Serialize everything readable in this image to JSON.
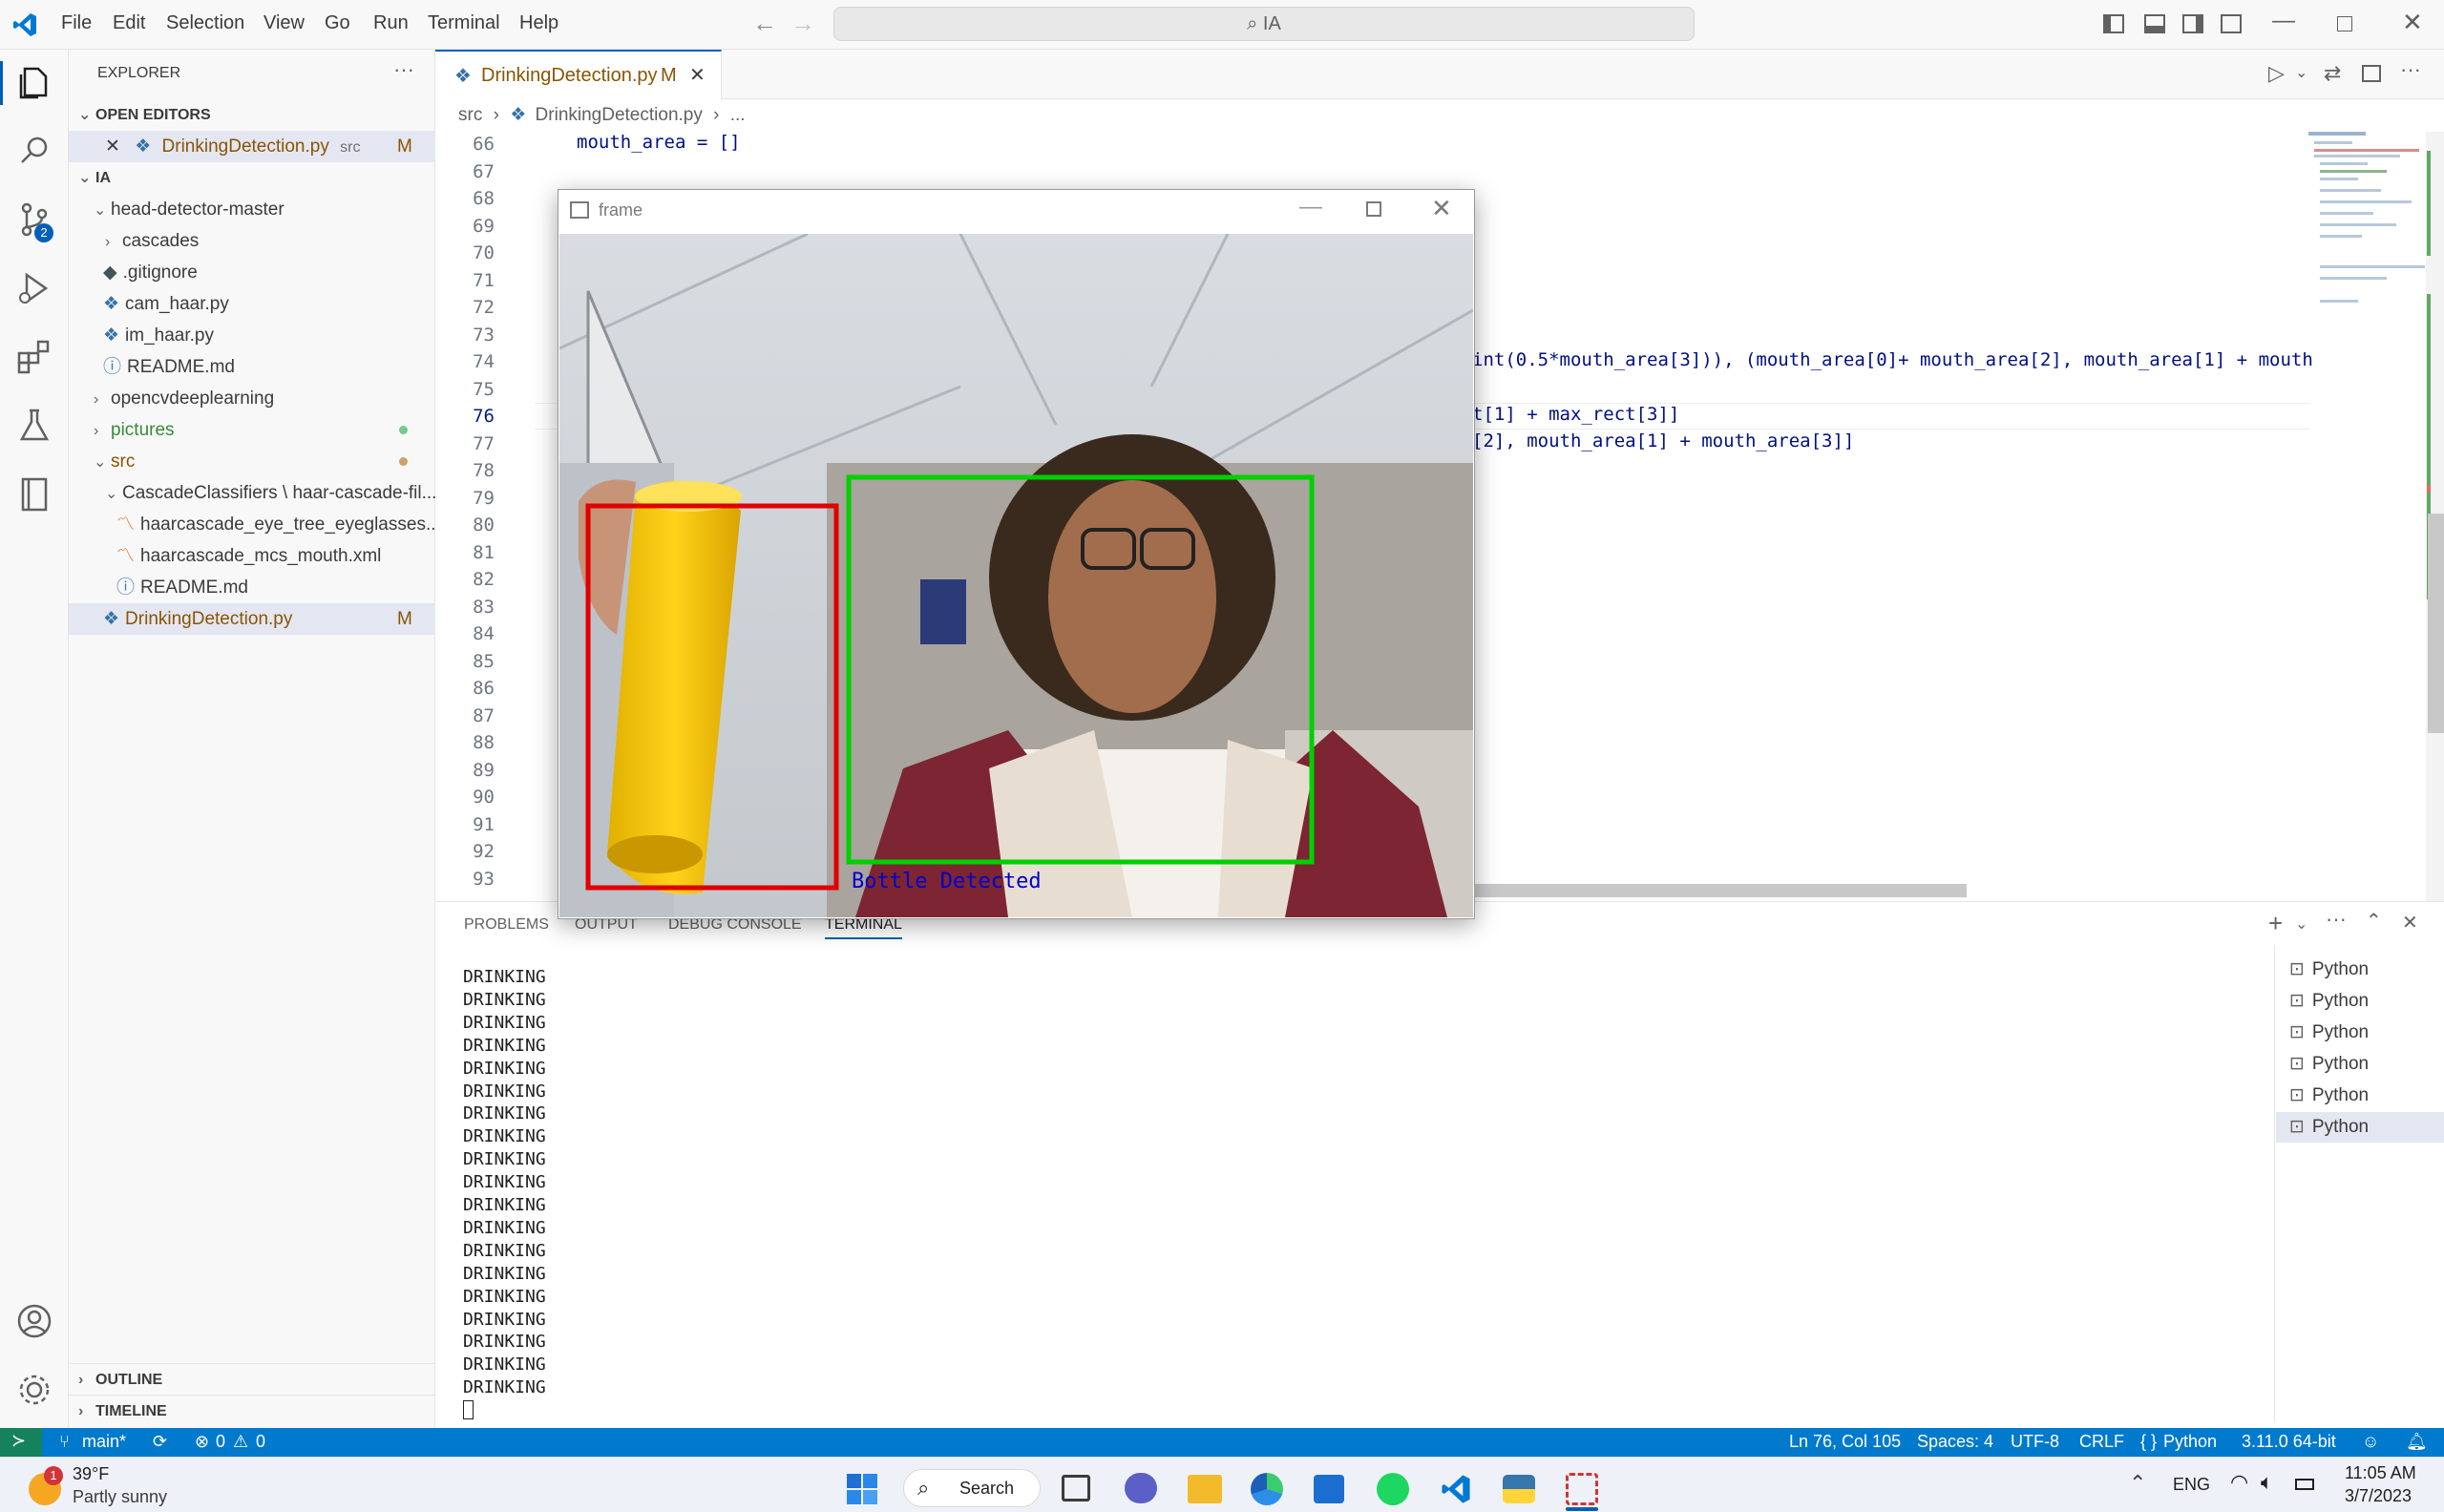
{
  "menu": [
    "File",
    "Edit",
    "Selection",
    "View",
    "Go",
    "Run",
    "Terminal",
    "Help"
  ],
  "search": {
    "text": "IA"
  },
  "activity_badge": "2",
  "sidebar": {
    "title": "EXPLORER",
    "open_editors_label": "OPEN EDITORS",
    "open_editor": {
      "name": "DrinkingDetection.py",
      "dir": "src",
      "status": "M"
    },
    "folder_label": "IA",
    "items": [
      {
        "label": "head-detector-master"
      },
      {
        "label": "cascades"
      },
      {
        "label": ".gitignore"
      },
      {
        "label": "cam_haar.py"
      },
      {
        "label": "im_haar.py"
      },
      {
        "label": "README.md"
      },
      {
        "label": "opencvdeeplearning"
      },
      {
        "label": "pictures"
      },
      {
        "label": "src"
      },
      {
        "label": "CascadeClassifiers \\ haar-cascade-fil..."
      },
      {
        "label": "haarcascade_eye_tree_eyeglasses...."
      },
      {
        "label": "haarcascade_mcs_mouth.xml"
      },
      {
        "label": "README.md"
      },
      {
        "label": "DrinkingDetection.py",
        "status": "M"
      }
    ],
    "outline_label": "OUTLINE",
    "timeline_label": "TIMELINE"
  },
  "tab": {
    "name": "DrinkingDetection.py",
    "status": "M"
  },
  "breadcrumbs": {
    "folder": "src",
    "file": "DrinkingDetection.py",
    "more": "..."
  },
  "editor": {
    "line_numbers": [
      "66",
      "67",
      "68",
      "69",
      "70",
      "71",
      "72",
      "73",
      "74",
      "75",
      "76",
      "77",
      "78",
      "79",
      "80",
      "81",
      "82",
      "83",
      "84",
      "85",
      "86",
      "87",
      "88",
      "89",
      "90",
      "91",
      "92",
      "93"
    ],
    "line_66": "mouth_area = []",
    "line_74": "int(0.5*mouth_area[3])), (mouth_area[0]+ mouth_area[2], mouth_area[1] + mouth",
    "line_76": "t[1] + max_rect[3]]",
    "line_77": "[2], mouth_area[1] + mouth_area[3]]"
  },
  "frame_window": {
    "title": "frame",
    "caption": "Bottle Detected",
    "box_colors": {
      "bottle": "#e00000",
      "face": "#00d000",
      "caption": "#0000cc"
    }
  },
  "panel": {
    "tabs": [
      "PROBLEMS",
      "OUTPUT",
      "DEBUG CONSOLE",
      "TERMINAL"
    ],
    "terminal_lines": [
      "DRINKING",
      "DRINKING",
      "DRINKING",
      "DRINKING",
      "DRINKING",
      "DRINKING",
      "DRINKING",
      "DRINKING",
      "DRINKING",
      "DRINKING",
      "DRINKING",
      "DRINKING",
      "DRINKING",
      "DRINKING",
      "DRINKING",
      "DRINKING",
      "DRINKING",
      "DRINKING",
      "DRINKING"
    ],
    "terminals": [
      "Python",
      "Python",
      "Python",
      "Python",
      "Python",
      "Python"
    ]
  },
  "status": {
    "branch": "main*",
    "errors": "0",
    "warnings": "0",
    "position": "Ln 76, Col 105",
    "spaces": "Spaces: 4",
    "encoding": "UTF-8",
    "eol": "CRLF",
    "language": "Python",
    "interpreter": "3.11.0 64-bit"
  },
  "taskbar": {
    "weather_temp": "39°F",
    "weather_desc": "Partly sunny",
    "weather_badge": "1",
    "search_label": "Search",
    "lang": "ENG",
    "time": "11:05 AM",
    "date": "3/7/2023"
  },
  "colors": {
    "accent": "#005fb8",
    "statusbar": "#007acc",
    "modified": "#895503",
    "git_added": "#388a34"
  }
}
